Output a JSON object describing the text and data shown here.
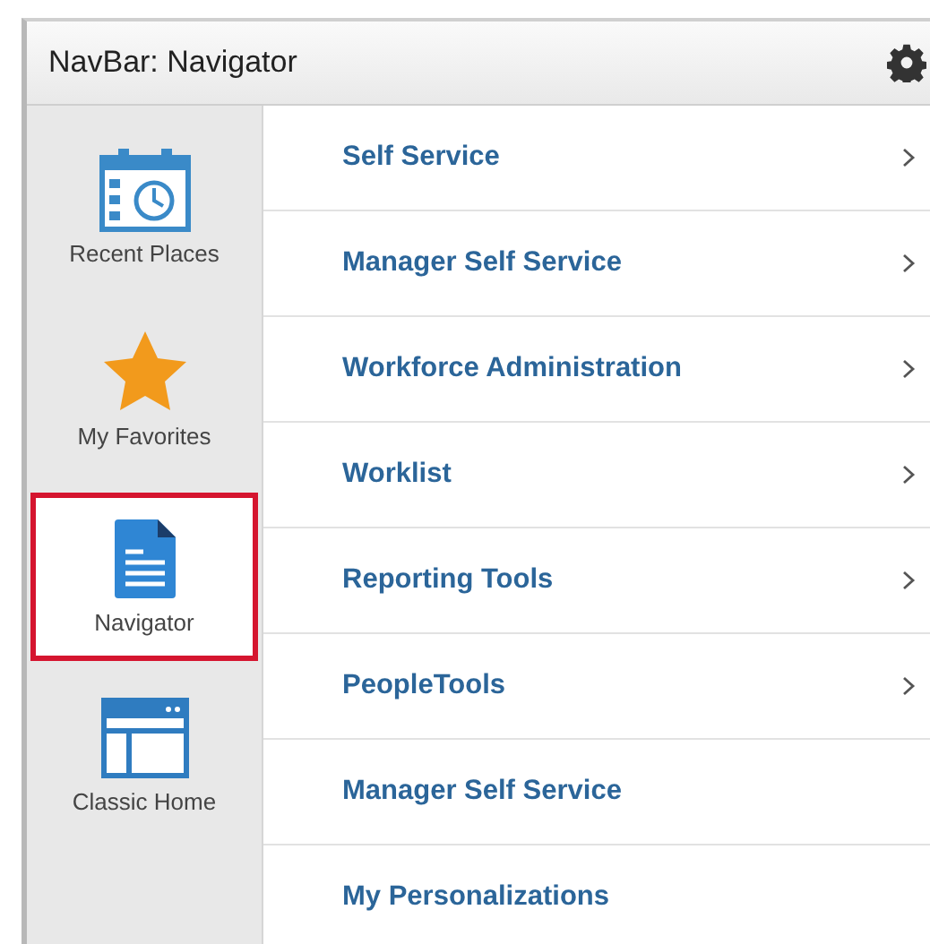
{
  "header": {
    "title": "NavBar: Navigator"
  },
  "sidebar": {
    "items": [
      {
        "label": "Recent Places",
        "kind": "recent",
        "selected": false
      },
      {
        "label": "My Favorites",
        "kind": "favorites",
        "selected": false
      },
      {
        "label": "Navigator",
        "kind": "navigator",
        "selected": true
      },
      {
        "label": "Classic Home",
        "kind": "classic",
        "selected": false
      }
    ]
  },
  "menu": {
    "items": [
      {
        "label": "Self Service",
        "has_children": true
      },
      {
        "label": "Manager Self Service",
        "has_children": true
      },
      {
        "label": "Workforce Administration",
        "has_children": true
      },
      {
        "label": "Worklist",
        "has_children": true
      },
      {
        "label": "Reporting Tools",
        "has_children": true
      },
      {
        "label": "PeopleTools",
        "has_children": true
      },
      {
        "label": "Manager Self Service",
        "has_children": false
      },
      {
        "label": "My Personalizations",
        "has_children": false
      }
    ]
  }
}
